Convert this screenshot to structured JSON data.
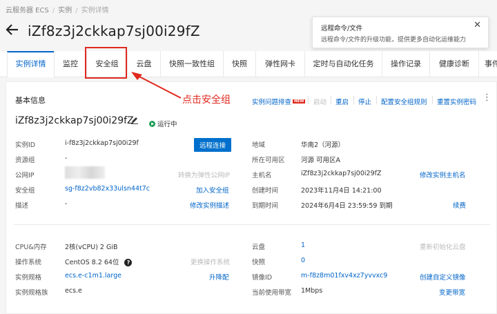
{
  "breadcrumb": [
    "云服务器 ECS",
    "实例",
    "实例详情"
  ],
  "title": "iZf8z3j2ckkap7sj00i29fZ",
  "tooltip": {
    "title": "远程命令/文件",
    "desc": "远程命令/文件的升级功能，提供更多自动化运维能力",
    "close": "✕"
  },
  "tabs": [
    {
      "label": "实例详情",
      "active": true
    },
    {
      "label": "监控"
    },
    {
      "label": "安全组"
    },
    {
      "label": "云盘"
    },
    {
      "label": "快照一致性组"
    },
    {
      "label": "快照"
    },
    {
      "label": "弹性网卡"
    },
    {
      "label": "定时与自动化任务"
    },
    {
      "label": "操作记录"
    },
    {
      "label": "健康诊断"
    },
    {
      "label": "事件"
    }
  ],
  "annotation": {
    "text": "点击安全组",
    "color": "#e0281e"
  },
  "basic": {
    "header": "基本信息",
    "instance_name": "iZf8z3j2ckkap7sj00i29fZ",
    "status": "运行中",
    "actions": {
      "troubleshoot": "实例问题排查",
      "new_badge": "NEW",
      "start": "启动",
      "restart": "重启",
      "stop": "停止",
      "config_sg": "配置安全组规则",
      "reset_password": "重置实例密码"
    }
  },
  "left_fields": {
    "instance_id_label": "实例ID",
    "instance_id": "i-f8z3j2ckkap7sj00i29f",
    "remote_connect": "远程连接",
    "resource_group_label": "资源组",
    "resource_group": "-",
    "public_ip_label": "公网IP",
    "convert_eip": "转换为弹性公网IP",
    "security_group_label": "安全组",
    "security_group": "sg-f8z2vb82x33ulsn44t7c",
    "join_sg": "加入安全组",
    "description_label": "描述",
    "description": "-",
    "edit_description": "修改实例描述"
  },
  "right_fields": {
    "region_label": "地域",
    "region": "华南2（河源）",
    "zone_label": "所在可用区",
    "zone": "河源 可用区A",
    "hostname_label": "主机名",
    "hostname": "iZf8z3j2ckkap7sj00i29fZ",
    "edit_hostname": "修改实例主机名",
    "created_label": "创建时间",
    "created": "2023年11月4日 14:21:00",
    "expire_label": "到期时间",
    "expire": "2024年6月4日 23:59:59 到期",
    "renew": "续费"
  },
  "spec_left": {
    "cpu_label": "CPU&内存",
    "cpu": "2核(vCPU) 2 GiB",
    "os_label": "操作系统",
    "os": "CentOS 8.2 64位",
    "help_icon": "?",
    "change_os": "更换操作系统",
    "spec_label": "实例规格",
    "spec": "ecs.e-c1m1.large",
    "upgrade": "升降配",
    "family_label": "实例规格族",
    "family": "ecs.e"
  },
  "spec_right": {
    "disk_label": "云盘",
    "disk": "1",
    "reinit_disk": "重新初始化云盘",
    "snapshot_label": "快照",
    "snapshot": "0",
    "image_label": "镜像ID",
    "image": "m-f8z8m01fxv4xz7yvvxc9",
    "create_image": "创建自定义镜像",
    "bandwidth_label": "当前使用带宽",
    "bandwidth": "1Mbps",
    "change_bandwidth": "变更带宽"
  }
}
